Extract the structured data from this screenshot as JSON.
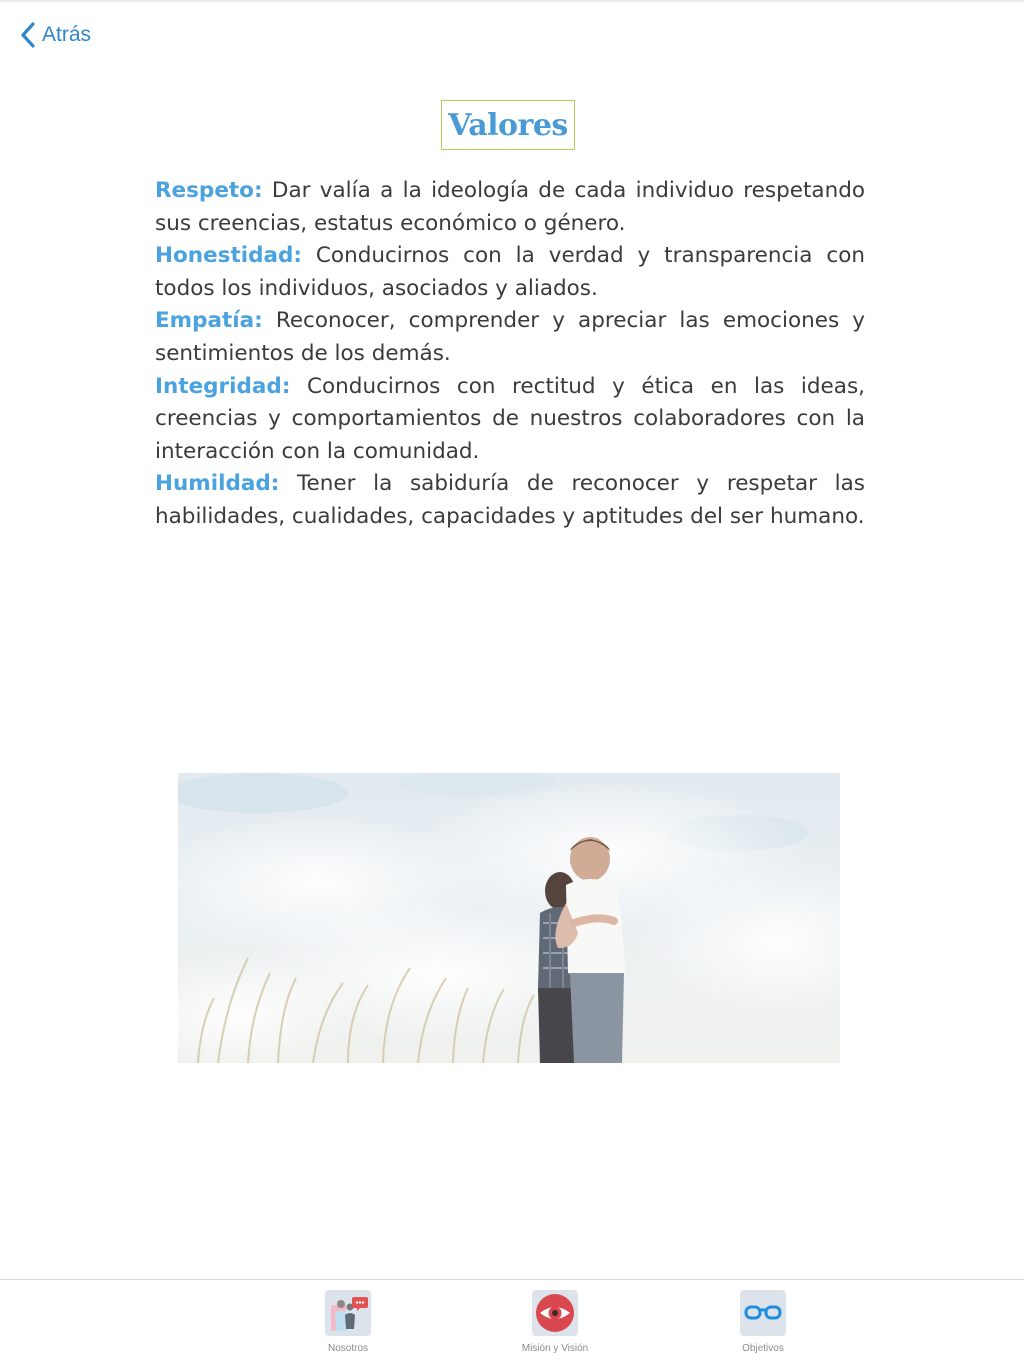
{
  "nav": {
    "back_label": "Atrás"
  },
  "title": "Valores",
  "values": [
    {
      "term": "Respeto:",
      "text": "Dar valía a la ideología de cada individuo respetando sus creencias, estatus económico o género."
    },
    {
      "term": "Honestidad:",
      "text": "Conducirnos con la verdad y transparencia con todos los individuos, asociados y aliados."
    },
    {
      "term": "Empatía:",
      "text": "Reconocer, comprender y apreciar las emociones y sentimientos de los demás."
    },
    {
      "term": "Integridad:",
      "text": "Conducirnos con rectitud y ética en las ideas, creencias y comportamientos de nuestros colaboradores con la interacción con la comunidad."
    },
    {
      "term": "Humildad:",
      "text": "Tener la sabiduría de reconocer y respetar las habilidades, cualidades, capacidades y aptitudes del ser humano."
    }
  ],
  "tabs": [
    {
      "label": "Nosotros",
      "icon": "people-chat-icon"
    },
    {
      "label": "Misión y Visión",
      "icon": "eye-icon"
    },
    {
      "label": "Objetivos",
      "icon": "glasses-icon"
    }
  ],
  "colors": {
    "accent": "#2f86c9",
    "term": "#4aa3df",
    "title": "#4a9ad6",
    "title_border": "#b6cf5a",
    "eye_red": "#d9474f"
  }
}
